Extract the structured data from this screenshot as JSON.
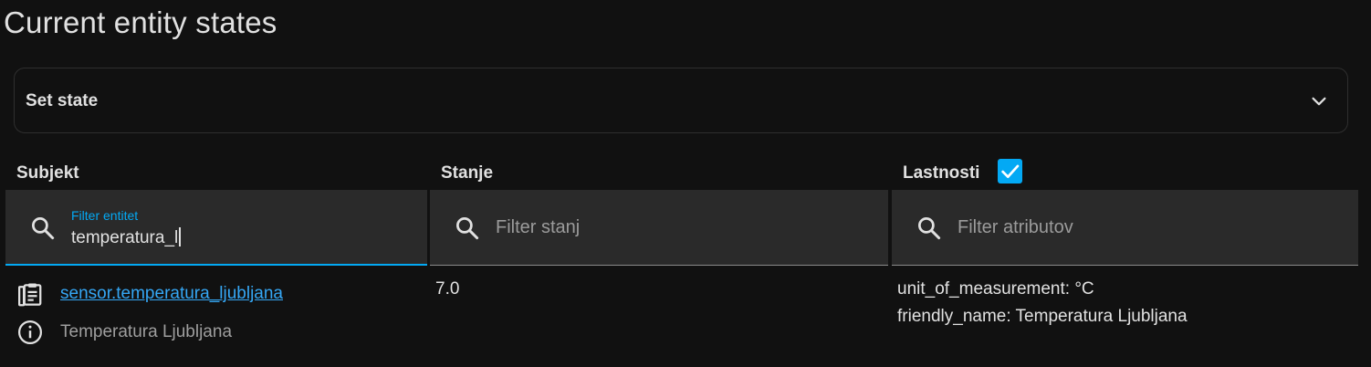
{
  "page": {
    "title": "Current entity states"
  },
  "set_state": {
    "label": "Set state",
    "expand_icon": "chevron-down-icon"
  },
  "columns": {
    "entity": "Subjekt",
    "state": "Stanje",
    "attributes": "Lastnosti",
    "attributes_checkbox_checked": true
  },
  "filters": {
    "entity": {
      "label": "Filter entitet",
      "value": "temperatura_l",
      "icon": "search-icon"
    },
    "state": {
      "placeholder": "Filter stanj",
      "value": "",
      "icon": "search-icon"
    },
    "attributes": {
      "placeholder": "Filter atributov",
      "value": "",
      "icon": "search-icon"
    }
  },
  "rows": [
    {
      "entity_id": "sensor.temperatura_ljubljana",
      "friendly_name": "Temperatura Ljubljana",
      "state": "7.0",
      "attributes": [
        "unit_of_measurement: °C",
        "friendly_name: Temperatura Ljubljana"
      ],
      "copy_icon": "clipboard-icon",
      "info_icon": "info-circle-icon"
    }
  ],
  "colors": {
    "accent": "#03a9f4",
    "link": "#35a7f5",
    "background": "#111111",
    "field": "#2a2a2a"
  }
}
